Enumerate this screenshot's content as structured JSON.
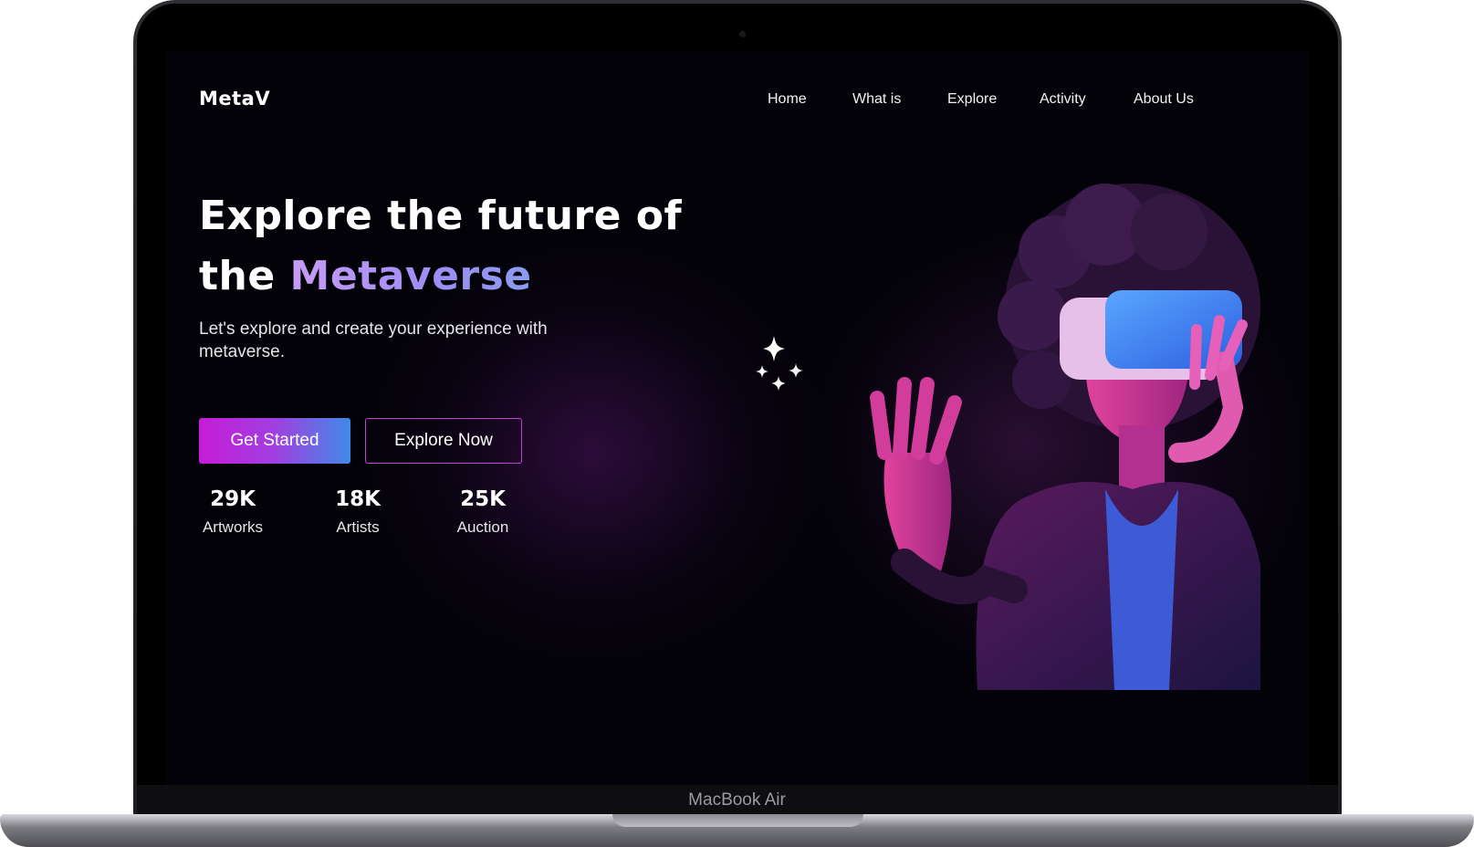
{
  "laptop": {
    "label": "MacBook Air"
  },
  "brand": {
    "logo": "MetaV"
  },
  "nav": [
    {
      "label": "Home"
    },
    {
      "label": "What is"
    },
    {
      "label": "Explore"
    },
    {
      "label": "Activity"
    },
    {
      "label": "About Us"
    }
  ],
  "hero": {
    "headline_line1": "Explore the future of",
    "headline_line2_prefix": "the ",
    "headline_accent": "Metaverse",
    "subtitle": "Let's explore and create your experience with metaverse.",
    "primary_button": "Get Started",
    "secondary_button": "Explore Now",
    "image_icon": "vr-headset-person-image",
    "sparkle_icon": "sparkles-icon"
  },
  "stats": [
    {
      "value": "29K",
      "label": "Artworks"
    },
    {
      "value": "18K",
      "label": "Artists"
    },
    {
      "value": "25K",
      "label": "Auction"
    }
  ],
  "colors": {
    "background": "#030208",
    "gradient_start": "#c61cd6",
    "gradient_end": "#3f8ae8",
    "accent_text": "#9d8df4",
    "outline_button": "#c43fd3"
  }
}
